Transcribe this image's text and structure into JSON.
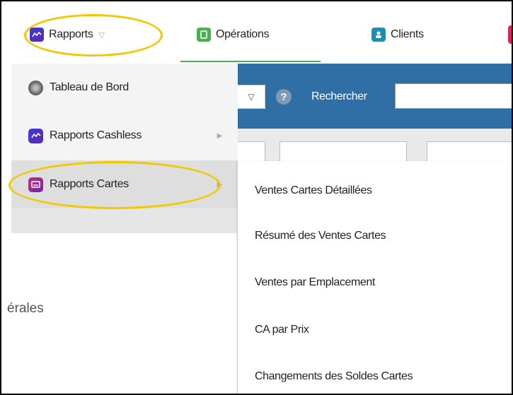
{
  "topnav": {
    "rapports_label": "Rapports",
    "operations_label": "Opérations",
    "clients_label": "Clients"
  },
  "searchbar": {
    "search_label": "Rechercher",
    "search_value": ""
  },
  "dropdown": {
    "items": [
      {
        "label": "Tableau de Bord",
        "icon": "dashboard-icon"
      },
      {
        "label": "Rapports Cashless",
        "icon": "chart-icon"
      },
      {
        "label": "Rapports Cartes",
        "icon": "cards-icon"
      }
    ]
  },
  "submenu": {
    "items": [
      {
        "label": "Ventes Cartes Détaillées"
      },
      {
        "label": "Résumé des Ventes Cartes"
      },
      {
        "label": "Ventes par Emplacement"
      },
      {
        "label": "CA par Prix"
      },
      {
        "label": "Changements des Soldes Cartes"
      }
    ]
  },
  "background": {
    "partial_text": "érales"
  },
  "colors": {
    "highlight_oval": "#f2c800",
    "toolbar_blue": "#2f6fa6",
    "operations_accent": "#4caf50"
  }
}
